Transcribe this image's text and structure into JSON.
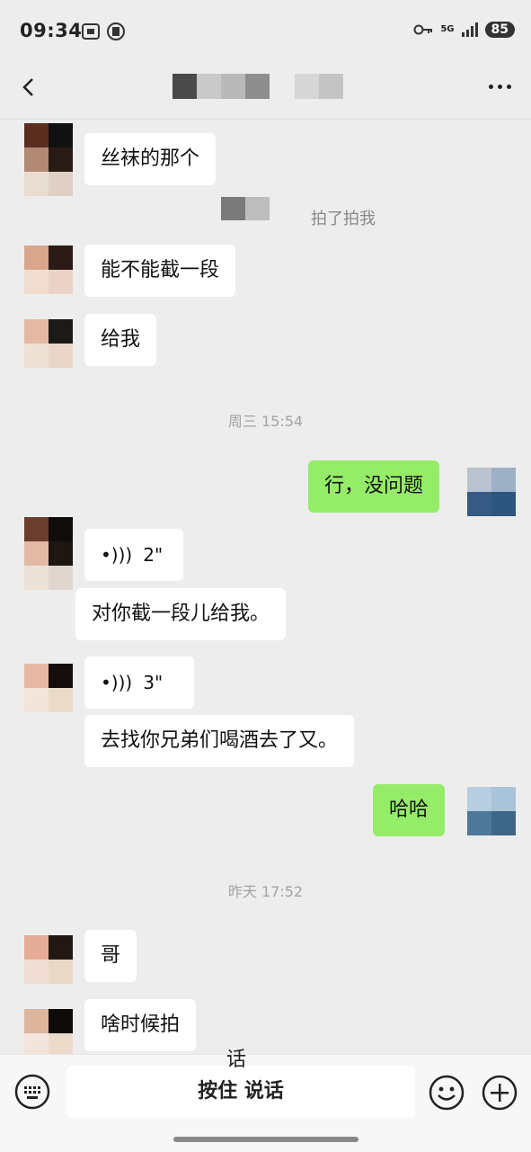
{
  "status_bar": {
    "time": "09:34",
    "network": "5G",
    "battery": "85"
  },
  "header": {
    "back_icon": "chevron-left-icon",
    "more_icon": "more-dots-icon"
  },
  "messages": [
    {
      "side": "left",
      "text": "丝袜的那个"
    },
    {
      "side": "system",
      "text": "拍了拍我"
    },
    {
      "side": "left",
      "text": "能不能截一段"
    },
    {
      "side": "left",
      "text": "给我"
    },
    {
      "side": "time",
      "text": "周三 15:54"
    },
    {
      "side": "right",
      "text": "行，没问题"
    },
    {
      "side": "left",
      "type": "voice",
      "duration": "2\"",
      "transcript": "对你截一段儿给我。"
    },
    {
      "side": "left",
      "type": "voice",
      "duration": "3\"",
      "transcript": "去找你兄弟们喝酒去了又。"
    },
    {
      "side": "right",
      "text": "哈哈"
    },
    {
      "side": "time",
      "text": "昨天 17:52"
    },
    {
      "side": "left",
      "text": "哥"
    },
    {
      "side": "left",
      "text": "啥时候拍"
    }
  ],
  "input_bar": {
    "hold_to_talk": "按住 说话",
    "floating_char": "话",
    "keyboard_icon": "keyboard-icon",
    "emoji_icon": "emoji-icon",
    "plus_icon": "plus-icon"
  },
  "colors": {
    "background": "#ededed",
    "my_bubble": "#95ec69",
    "their_bubble": "#ffffff"
  }
}
